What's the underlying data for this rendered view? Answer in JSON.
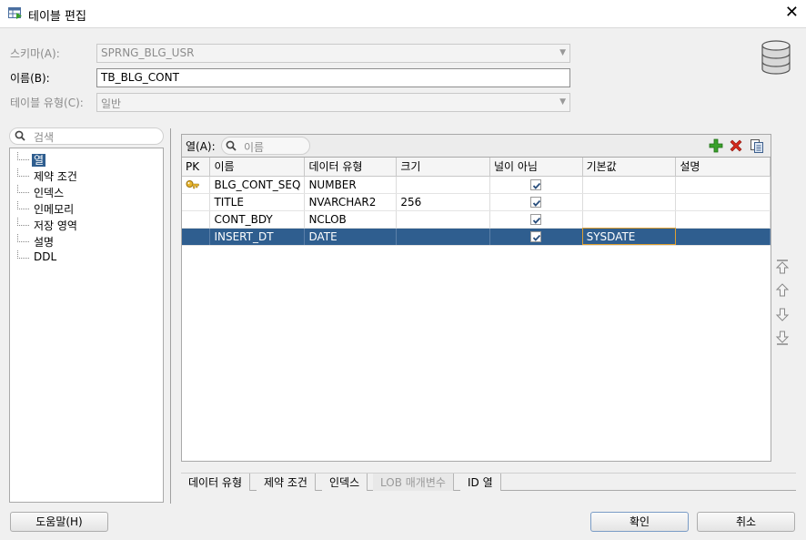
{
  "window": {
    "title": "테이블 편집",
    "close_glyph": "✕"
  },
  "form": {
    "schema_label": "스키마(A):",
    "schema_value": "SPRNG_BLG_USR",
    "name_label": "이름(B):",
    "name_value": "TB_BLG_CONT",
    "table_type_label": "테이블 유형(C):",
    "table_type_value": "일반"
  },
  "sidebar": {
    "search_placeholder": "검색",
    "items": [
      {
        "label": "열",
        "selected": true
      },
      {
        "label": "제약 조건"
      },
      {
        "label": "인덱스"
      },
      {
        "label": "인메모리"
      },
      {
        "label": "저장 영역"
      },
      {
        "label": "설명"
      },
      {
        "label": "DDL"
      }
    ]
  },
  "columns_panel": {
    "label": "열(A):",
    "filter_placeholder": "이름",
    "headers": [
      "PK",
      "이름",
      "데이터 유형",
      "크기",
      "널이 아님",
      "기본값",
      "설명"
    ],
    "rows": [
      {
        "pk": true,
        "name": "BLG_CONT_SEQ",
        "type": "NUMBER",
        "size": "",
        "not_null": true,
        "default": "",
        "comment": ""
      },
      {
        "pk": false,
        "name": "TITLE",
        "type": "NVARCHAR2",
        "size": "256",
        "not_null": true,
        "default": "",
        "comment": ""
      },
      {
        "pk": false,
        "name": "CONT_BDY",
        "type": "NCLOB",
        "size": "",
        "not_null": true,
        "default": "",
        "comment": ""
      },
      {
        "pk": false,
        "name": "INSERT_DT",
        "type": "DATE",
        "size": "",
        "not_null": true,
        "default": "SYSDATE",
        "comment": ""
      }
    ],
    "selected_row": 3
  },
  "bottom_tabs": [
    {
      "label": "데이터 유형"
    },
    {
      "label": "제약 조건"
    },
    {
      "label": "인덱스"
    },
    {
      "label": "LOB 매개변수",
      "disabled": true
    },
    {
      "label": "ID 열"
    }
  ],
  "buttons": {
    "help": "도움말(H)",
    "ok": "확인",
    "cancel": "취소"
  },
  "colors": {
    "selection": "#2f5e8f",
    "add_green": "#3aa12b",
    "delete_red": "#d42a1c"
  },
  "icons": [
    "table-edit-icon",
    "database-icon",
    "search-icon",
    "add-icon",
    "delete-icon",
    "copy-icon",
    "key-icon",
    "checkbox-checked-icon",
    "move-top-icon",
    "move-up-icon",
    "move-down-icon",
    "move-bottom-icon"
  ]
}
